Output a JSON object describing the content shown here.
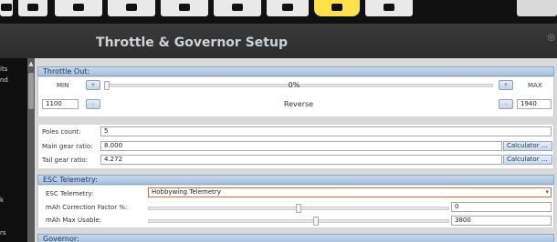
{
  "title": "Throttle & Governor Setup",
  "toolbar": {
    "icons": [
      {
        "name": "toolbar-icon-1"
      },
      {
        "name": "toolbar-icon-2"
      },
      {
        "name": "toolbar-icon-3"
      },
      {
        "name": "toolbar-icon-4"
      },
      {
        "name": "toolbar-icon-5"
      },
      {
        "name": "toolbar-icon-6"
      },
      {
        "name": "toolbar-icon-7"
      },
      {
        "name": "toolbar-icon-8"
      },
      {
        "name": "toolbar-icon-9"
      }
    ]
  },
  "leftnav": {
    "fragments": [
      "its",
      "nd",
      "k",
      "rs"
    ]
  },
  "throttle_out": {
    "header": "Throttle Out:",
    "min_label": "MIN",
    "max_label": "MAX",
    "percent": "0%",
    "min_value": "1100",
    "max_value": "1940",
    "reverse_label": "Reverse",
    "slider_level": 0,
    "plus_symbol": "+",
    "minus_symbol": "-"
  },
  "poles": {
    "label": "Poles count:",
    "value": "5"
  },
  "main_gear": {
    "label": "Main gear ratio:",
    "value": "8.000",
    "button": "Calculator ..."
  },
  "tail_gear": {
    "label": "Tail gear ratio:",
    "value": "4.272",
    "button": "Calculator ..."
  },
  "esc_telemetry": {
    "header": "ESC Telemetry:",
    "type_label": "ESC Telemetry:",
    "type_value": "Hobbywing Telemetry",
    "correction_label": "mAh Correction Factor %:",
    "correction_value": "0",
    "correction_level": 0.5,
    "usable_label": "mAh Max Usable:",
    "usable_value": "3800",
    "usable_level": 0.56
  },
  "governor": {
    "header": "Governor:"
  }
}
